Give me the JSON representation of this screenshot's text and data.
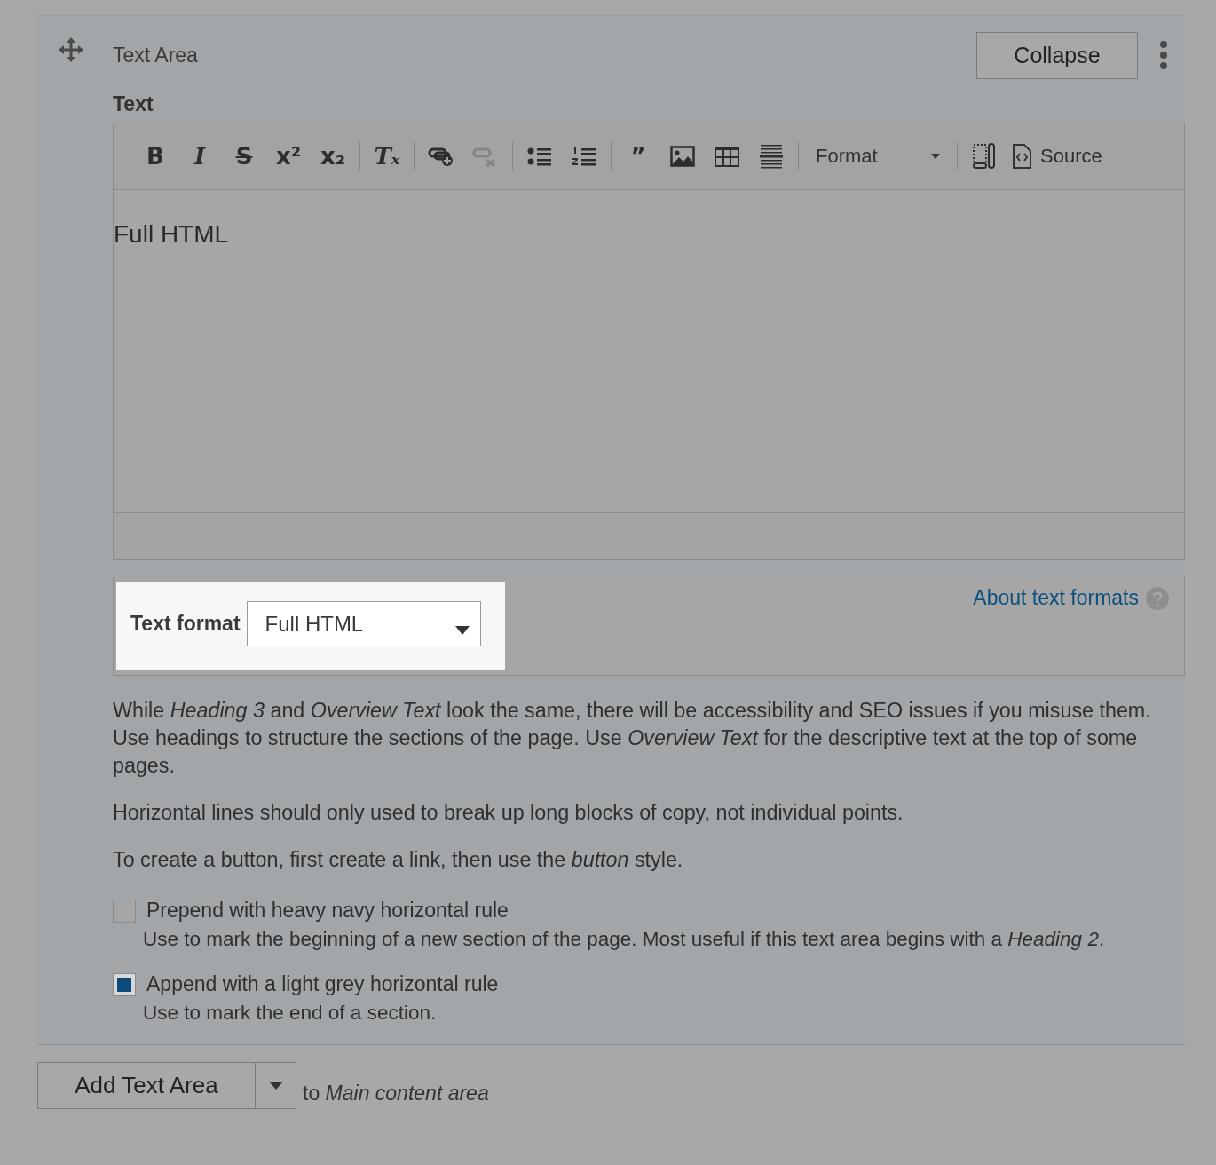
{
  "panel": {
    "title": "Text Area",
    "collapse_button": "Collapse"
  },
  "field": {
    "label": "Text",
    "toolbar": [
      {
        "kind": "bold",
        "glyph": "B",
        "disabled": false
      },
      {
        "kind": "italic",
        "glyph": "I",
        "disabled": false
      },
      {
        "kind": "strike",
        "glyph": "S",
        "disabled": false
      },
      {
        "kind": "bold",
        "glyph": "x²",
        "disabled": false
      },
      {
        "kind": "bold",
        "glyph": "x₂",
        "disabled": false
      },
      {
        "kind": "separator"
      },
      {
        "kind": "italic",
        "glyph": "Tₓ",
        "disabled": false
      },
      {
        "kind": "separator"
      },
      {
        "kind": "link",
        "disabled": false
      },
      {
        "kind": "unlink",
        "disabled": true
      },
      {
        "kind": "separator"
      },
      {
        "kind": "bulleted",
        "disabled": false
      },
      {
        "kind": "numbered",
        "disabled": false
      },
      {
        "kind": "separator"
      },
      {
        "kind": "bold",
        "glyph": "”",
        "disabled": false
      },
      {
        "kind": "image",
        "disabled": false
      },
      {
        "kind": "table",
        "disabled": false
      },
      {
        "kind": "hrule",
        "disabled": false
      },
      {
        "kind": "separator"
      },
      {
        "kind": "dropdown",
        "label": "Format"
      },
      {
        "kind": "separator"
      },
      {
        "kind": "showblocks",
        "disabled": false
      },
      {
        "kind": "source",
        "label": "Source",
        "disabled": false
      }
    ],
    "content": "Full HTML",
    "text_format": {
      "label": "Text format",
      "value": "Full HTML",
      "help_link": "About text formats"
    }
  },
  "help": [
    "While *Heading 3* and *Overview Text* look the same, there will be accessibility and SEO issues if you misuse them. Use headings to structure the sections of the page. Use *Overview Text* for the descriptive text at the top of some pages.",
    "Horizontal lines should only used to break up long blocks of copy, not individual points.",
    "To create a button, first create a link, then use the *button* style."
  ],
  "options": [
    {
      "label": "Prepend with heavy navy horizontal rule",
      "checked": false,
      "description": "Use to mark the beginning of a new section of the page. Most useful if this text area begins with a *Heading 2*."
    },
    {
      "label": "Append with a light grey horizontal rule",
      "checked": true,
      "description": "Use to mark the end of a section."
    }
  ],
  "add": {
    "button": "Add Text Area",
    "target": "to *Main content area*"
  }
}
